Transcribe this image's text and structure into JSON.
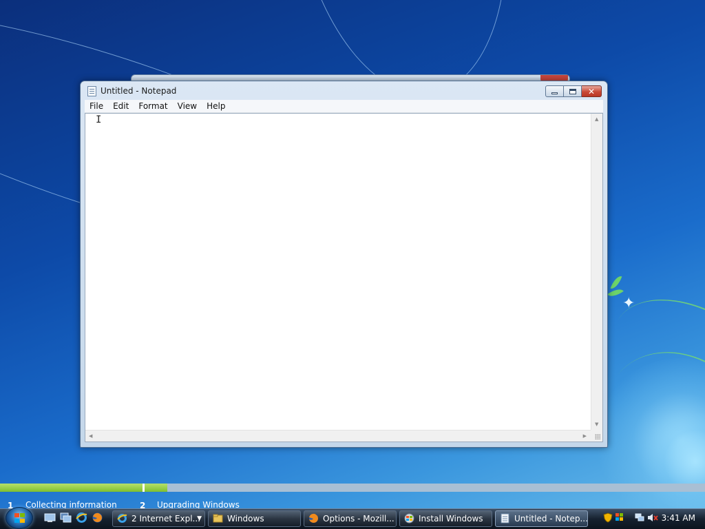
{
  "window": {
    "title": "Untitled - Notepad",
    "menu": [
      "File",
      "Edit",
      "Format",
      "View",
      "Help"
    ],
    "content": "",
    "cursor": "I"
  },
  "setup": {
    "steps": [
      {
        "number": "1",
        "label": "Collecting information"
      },
      {
        "number": "2",
        "label": "Upgrading Windows"
      }
    ],
    "step1_progress": 1.0,
    "step2_progress": 0.04
  },
  "taskbar": {
    "quick_launch": [
      "show-desktop-icon",
      "switch-windows-icon",
      "internet-explorer-icon",
      "firefox-icon"
    ],
    "tasks": [
      {
        "label": "2 Internet Expl...",
        "icon": "internet-explorer-icon",
        "group": true
      },
      {
        "label": "Windows",
        "icon": "folder-icon"
      },
      {
        "label": "Options - Mozill...",
        "icon": "firefox-icon"
      },
      {
        "label": "Install Windows",
        "icon": "windows-setup-icon"
      },
      {
        "label": "Untitled - Notep...",
        "icon": "notepad-icon",
        "active": true
      }
    ],
    "clock": "3:41 AM"
  },
  "colors": {
    "desktop_blue": "#0d4aa8",
    "progress_green": "#7fbf2f",
    "close_red": "#c94a38"
  }
}
